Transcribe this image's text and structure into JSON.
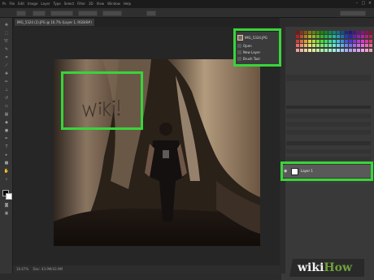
{
  "menu": {
    "items": [
      "Ps",
      "File",
      "Edit",
      "Image",
      "Layer",
      "Type",
      "Select",
      "Filter",
      "3D",
      "View",
      "Window",
      "Help"
    ],
    "window_controls": [
      "–",
      "□",
      "×"
    ]
  },
  "document": {
    "tab_label": "IMG_5324 (2).JPG @ 16.7% (Layer 1, RGB/8#)"
  },
  "status": {
    "zoom": "16.67%",
    "doc_size": "Doc: 43.9M/43.9M"
  },
  "history": {
    "snapshot_label": "IMG_5324.JPG",
    "steps": [
      "Open",
      "New Layer",
      "Brush Tool"
    ]
  },
  "layers": {
    "selected_layer_name": "Layer 1"
  },
  "canvas": {
    "handwriting_text": "WiKi"
  },
  "watermark": {
    "wiki": "wiki",
    "how": "How"
  },
  "colors": {
    "highlight": "#39d43a",
    "brand_green": "#6f9f3c"
  },
  "icons": {
    "visibility": "eye-icon",
    "tools": "toolbar-tool-icons"
  }
}
